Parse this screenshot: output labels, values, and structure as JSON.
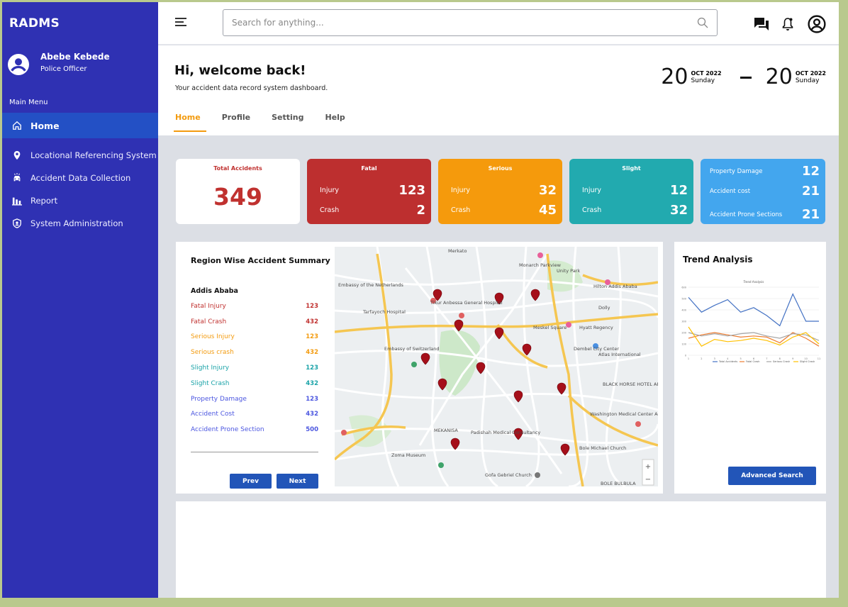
{
  "app": {
    "name": "RADMS"
  },
  "user": {
    "name": "Abebe Kebede",
    "role": "Police Officer"
  },
  "sidebar": {
    "menu_title": "Main Menu",
    "items": [
      {
        "label": "Home",
        "icon": "home-icon"
      },
      {
        "label": "Locational Referencing System",
        "icon": "location-pin-icon"
      },
      {
        "label": "Accident Data Collection",
        "icon": "car-crash-icon"
      },
      {
        "label": "Report",
        "icon": "bar-chart-icon"
      },
      {
        "label": "System Administration",
        "icon": "shield-user-icon"
      }
    ]
  },
  "search": {
    "placeholder": "Search for anything..."
  },
  "header": {
    "welcome": "Hi, welcome back!",
    "subtitle": "Your accident data record system dashboard.",
    "date_from": {
      "day": "20",
      "month": "OCT 2022",
      "weekday": "Sunday"
    },
    "date_to": {
      "day": "20",
      "month": "OCT 2022",
      "weekday": "Sunday"
    }
  },
  "tabs": [
    "Home",
    "Profile",
    "Setting",
    "Help"
  ],
  "cards": {
    "total": {
      "title": "Total Accidents",
      "value": "349"
    },
    "fatal": {
      "title": "Fatal",
      "injury_label": "Injury",
      "injury": "123",
      "crash_label": "Crash",
      "crash": "2",
      "color": "#bd2f2f"
    },
    "serious": {
      "title": "Serious",
      "injury_label": "Injury",
      "injury": "32",
      "crash_label": "Crash",
      "crash": "45",
      "color": "#f59a0c"
    },
    "slight": {
      "title": "Slight",
      "injury_label": "Injury",
      "injury": "12",
      "crash_label": "Crash",
      "crash": "32",
      "color": "#22aaaf"
    },
    "property": {
      "rows": [
        {
          "label": "Property Damage",
          "value": "12"
        },
        {
          "label": "Accident cost",
          "value": "21"
        },
        {
          "label": "Accident Prone Sections",
          "value": "21"
        }
      ],
      "color": "#43a6ee"
    }
  },
  "summary": {
    "title": "Region Wise Accident Summary",
    "region": "Addis Ababa",
    "rows": [
      {
        "label": "Fatal Injury",
        "value": "123",
        "color": "#c0312f"
      },
      {
        "label": "Fatal Crash",
        "value": "432",
        "color": "#c0312f"
      },
      {
        "label": "Serious Injury",
        "value": "123",
        "color": "#f39b0f"
      },
      {
        "label": "Serious crash",
        "value": "432",
        "color": "#f39b0f"
      },
      {
        "label": "Slight Injury",
        "value": "123",
        "color": "#1aa3a8"
      },
      {
        "label": "Slight Crash",
        "value": "432",
        "color": "#1aa3a8"
      },
      {
        "label": "Property Damage",
        "value": "123",
        "color": "#4b56e0"
      },
      {
        "label": "Accident Cost",
        "value": "432",
        "color": "#4b56e0"
      },
      {
        "label": "Accident Prone Section",
        "value": "500",
        "color": "#4b56e0"
      }
    ],
    "prev": "Prev",
    "next": "Next"
  },
  "map": {
    "labels": [
      "Merkato",
      "Monarch Parkview",
      "Unity Park",
      "Embassy of the Netherlands",
      "Tikur Anbessa General Hospital",
      "Tarfayoch Hospital",
      "Embassy of Switzerland",
      "Hyatt Regency",
      "Meskel Square",
      "Dembel City Center",
      "BLACK HORSE HOTEL APARTMENT",
      "Washington Medical Center Addis Ababa",
      "Padishah Medical Consultancy",
      "Bole Michael Church",
      "Zoma Museum",
      "Gofa Gebriel Church",
      "BOLE BULBULA",
      "MEKANISA",
      "Hilton Addis Ababa",
      "Atlas International",
      "Dolly"
    ]
  },
  "trend": {
    "title": "Trend Analysis",
    "button": "Advanced Search"
  },
  "chart_data": {
    "type": "line",
    "title": "Trend Analysis",
    "x": [
      "1",
      "2",
      "3",
      "4",
      "5",
      "6",
      "7",
      "8",
      "9",
      "10",
      "11"
    ],
    "ylim": [
      0,
      600
    ],
    "series": [
      {
        "name": "Total Accidents",
        "color": "#4472c4",
        "values": [
          510,
          380,
          440,
          490,
          380,
          420,
          350,
          260,
          540,
          300,
          300
        ]
      },
      {
        "name": "Fatal Crash",
        "color": "#ed7d31",
        "values": [
          150,
          180,
          200,
          180,
          160,
          170,
          160,
          110,
          200,
          150,
          80
        ]
      },
      {
        "name": "Serious Crash",
        "color": "#a5a5a5",
        "values": [
          200,
          170,
          190,
          170,
          190,
          200,
          170,
          150,
          190,
          180,
          130
        ]
      },
      {
        "name": "Slight Crash",
        "color": "#ffc000",
        "values": [
          250,
          80,
          140,
          120,
          130,
          150,
          130,
          90,
          160,
          200,
          100
        ]
      }
    ]
  }
}
